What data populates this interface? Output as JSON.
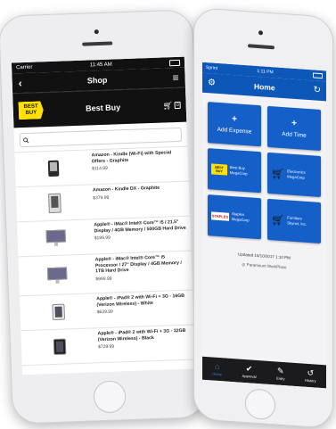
{
  "left_phone": {
    "status": {
      "carrier": "Carrier",
      "time": "11:45 AM"
    },
    "nav": {
      "title": "Shop"
    },
    "store": {
      "name": "Best Buy",
      "logo_text": [
        "BEST",
        "BUY"
      ],
      "cart_count": "0"
    },
    "search": {
      "placeholder": ""
    },
    "products": [
      {
        "name": "Amazon - Kindle (Wi-Fi) with Special Offers - Graphite",
        "price": "$114.99"
      },
      {
        "name": "Amazon - Kindle DX - Graphite",
        "price": "$379.99"
      },
      {
        "name": "Apple® - iMac® Intel® Core™ i5 / 21.5\" Display / 4GB Memory / 500GB Hard Drive",
        "price": "$199.99"
      },
      {
        "name": "Apple® - iMac® Intel® Core™ i5 Processor / 27\" Display / 4GB Memory / 1TB Hard Drive",
        "price": "$999.99"
      },
      {
        "name": "Apple® - iPad® 2 with Wi-Fi + 3G - 16GB (Verizon Wireless) - White",
        "price": "$629.99"
      },
      {
        "name": "Apple® - iPad® 2 with Wi-Fi + 3G - 32GB (Verizon Wireless) - Black",
        "price": "$729.99"
      }
    ]
  },
  "right_phone": {
    "status": {
      "carrier": "Sprint",
      "time": "1:11 PM"
    },
    "nav": {
      "title": "Home"
    },
    "tiles": {
      "add_expense": {
        "plus": "+",
        "label": "Add Expense"
      },
      "add_time": {
        "plus": "+",
        "label": "Add Time"
      },
      "best_buy": {
        "logo": [
          "BEST",
          "BUY"
        ],
        "text": [
          "Best Buy",
          "MegaCorp"
        ]
      },
      "electronics": {
        "text": [
          "Electronics",
          "MegaCorp"
        ]
      },
      "staples": {
        "logo": "STAPLES",
        "text": [
          "Staples",
          "MegaCorp"
        ]
      },
      "furniture": {
        "text": [
          "Furniture",
          "Skynet, Inc."
        ]
      }
    },
    "updated": "Updated 10/10/2017 1:10 PM",
    "brand": "Paramount WorkPlace",
    "tabs": [
      {
        "label": "Home"
      },
      {
        "label": "Approval"
      },
      {
        "label": "Entry"
      },
      {
        "label": "History"
      }
    ],
    "colors": {
      "primary": "#0d57b8",
      "tile": "#1560c8",
      "tabbar": "#1b1b1d",
      "active_tab": "#2f8be8"
    }
  }
}
